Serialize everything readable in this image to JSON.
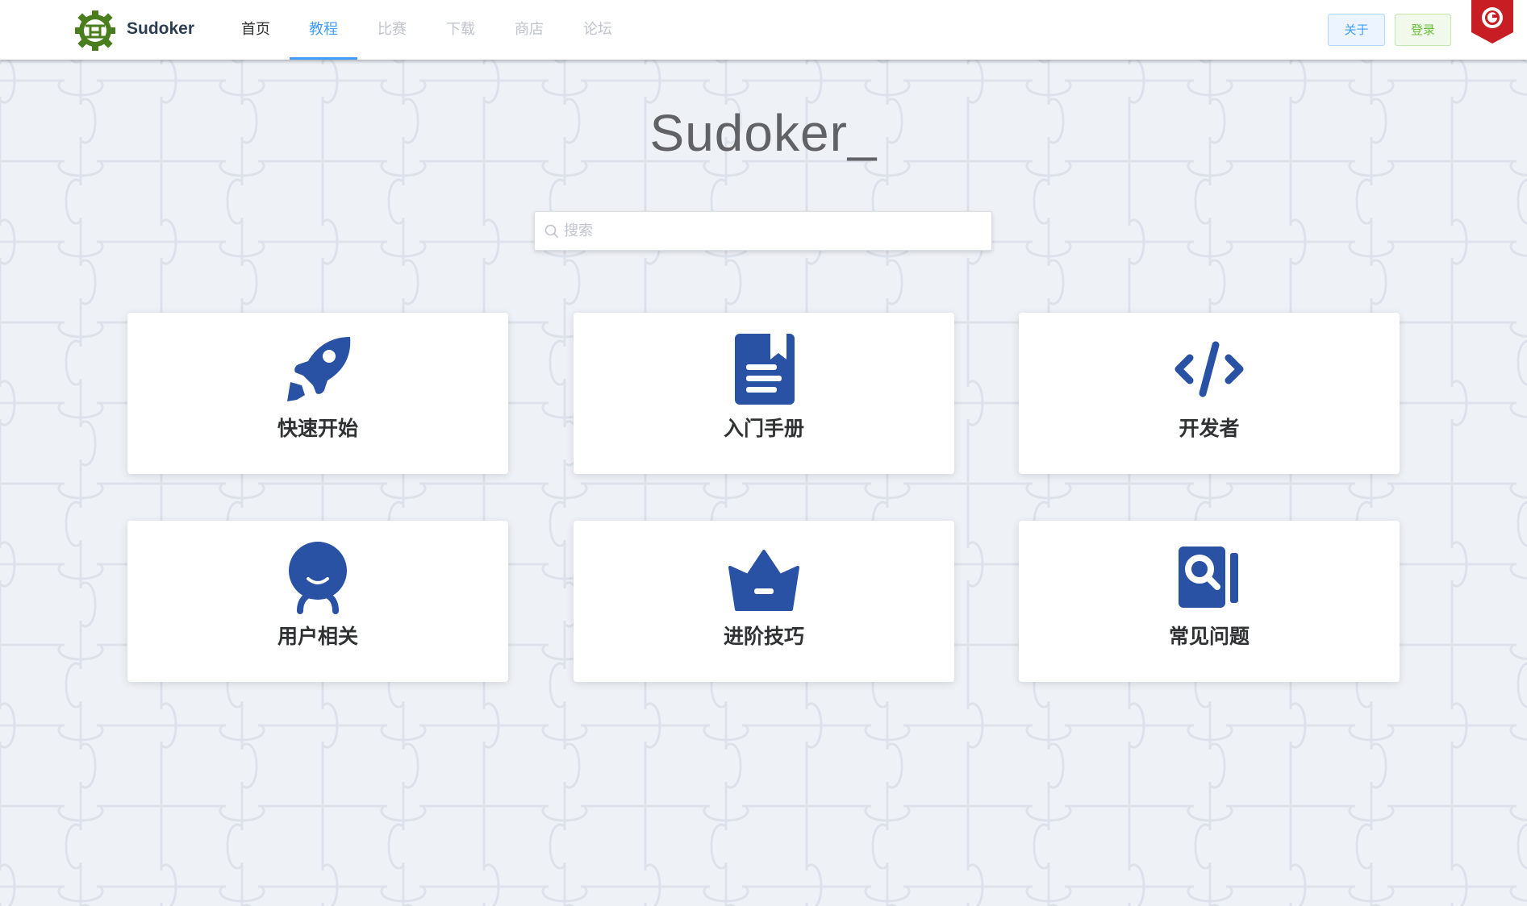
{
  "header": {
    "brand": "Sudoker",
    "nav": [
      {
        "label": "首页",
        "state": "normal"
      },
      {
        "label": "教程",
        "state": "active"
      },
      {
        "label": "比赛",
        "state": "disabled"
      },
      {
        "label": "下载",
        "state": "disabled"
      },
      {
        "label": "商店",
        "state": "disabled"
      },
      {
        "label": "论坛",
        "state": "disabled"
      }
    ],
    "about_label": "关于",
    "login_label": "登录"
  },
  "main": {
    "title": "Sudoker_",
    "search": {
      "placeholder": "搜索",
      "value": ""
    },
    "cards": [
      {
        "label": "快速开始",
        "icon": "rocket-icon"
      },
      {
        "label": "入门手册",
        "icon": "book-icon"
      },
      {
        "label": "开发者",
        "icon": "code-icon"
      },
      {
        "label": "用户相关",
        "icon": "user-icon"
      },
      {
        "label": "进阶技巧",
        "icon": "crown-icon"
      },
      {
        "label": "常见问题",
        "icon": "search-book-icon"
      }
    ]
  },
  "colors": {
    "accent": "#409eff",
    "icon": "#2a52a4",
    "logo": "#4a7d1e",
    "gitee": "#c71d23",
    "background": "#eef1f6"
  }
}
